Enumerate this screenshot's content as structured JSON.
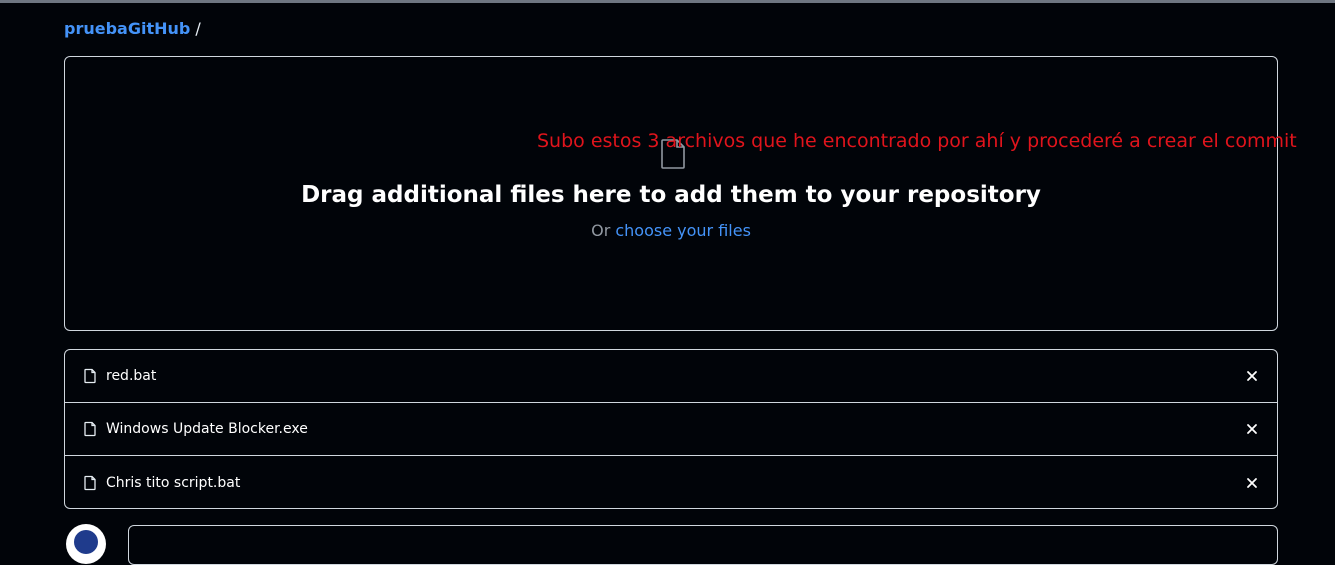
{
  "breadcrumb": {
    "repo": "pruebaGitHub",
    "separator": "/"
  },
  "dropzone": {
    "title": "Drag additional files here to add them to your repository",
    "or_text": "Or",
    "choose_link": "choose your files",
    "icon": "file-icon"
  },
  "annotation": {
    "text": "Subo estos 3 archivos que he encontrado por ahí y procederé a crear el commit",
    "color": "#e0141c"
  },
  "files": [
    {
      "name": "red.bat",
      "icon": "file-icon",
      "remove_icon": "close-icon"
    },
    {
      "name": "Windows Update Blocker.exe",
      "icon": "file-icon",
      "remove_icon": "close-icon"
    },
    {
      "name": "Chris tito script.bat",
      "icon": "file-icon",
      "remove_icon": "close-icon"
    }
  ],
  "colors": {
    "background": "#010409",
    "link": "#4493f8",
    "border": "#d0d7de",
    "text": "#e6edf3"
  }
}
